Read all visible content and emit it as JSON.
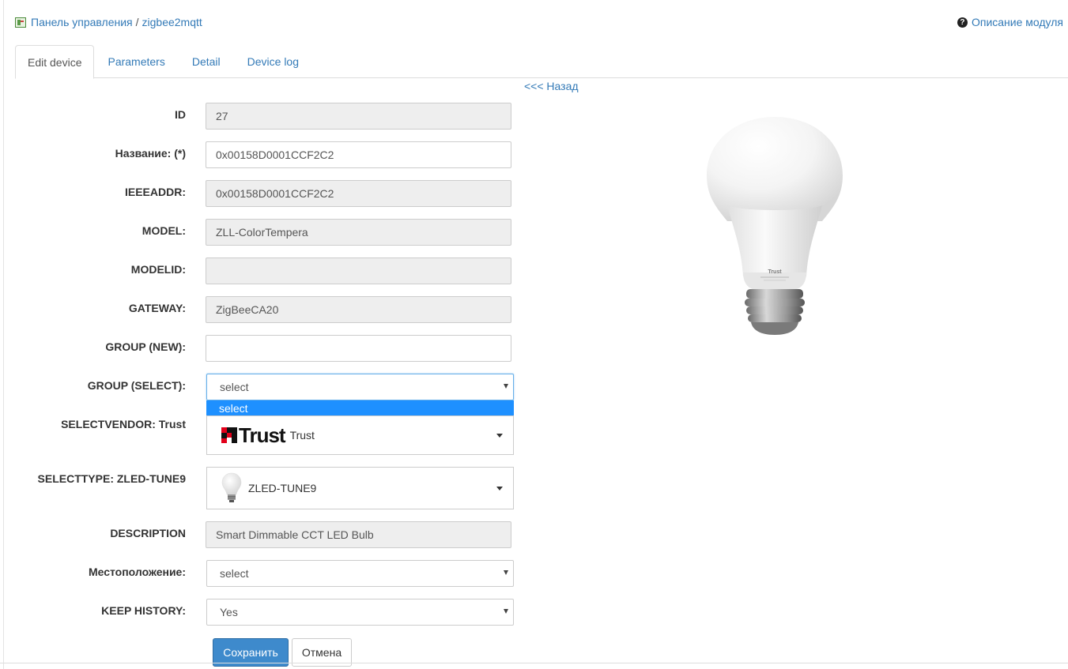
{
  "breadcrumb": {
    "home": "Панель управления",
    "separator": "/",
    "module": "zigbee2mqtt"
  },
  "help": {
    "icon": "question-circle-icon",
    "label": "Описание модуля"
  },
  "tabs": [
    {
      "label": "Edit device",
      "active": true
    },
    {
      "label": "Parameters",
      "active": false
    },
    {
      "label": "Detail",
      "active": false
    },
    {
      "label": "Device log",
      "active": false
    }
  ],
  "back_link": "<<< Назад",
  "form": {
    "id": {
      "label": "ID",
      "value": "27"
    },
    "name": {
      "label": "Название: (*)",
      "value": "0x00158D0001CCF2C2"
    },
    "ieeeaddr": {
      "label": "IEEEADDR:",
      "value": "0x00158D0001CCF2C2"
    },
    "model": {
      "label": "MODEL:",
      "value": "ZLL-ColorTempera"
    },
    "modelid": {
      "label": "MODELID:",
      "value": ""
    },
    "gateway": {
      "label": "GATEWAY:",
      "value": "ZigBeeCA20"
    },
    "group_new": {
      "label": "GROUP (NEW):",
      "value": ""
    },
    "group_select": {
      "label": "GROUP (SELECT):",
      "value": "select",
      "open_option": "select"
    },
    "vendor": {
      "label": "SELECTVENDOR: Trust",
      "logo_text": "Trust",
      "value": "Trust"
    },
    "type": {
      "label": "SELECTTYPE: ZLED-TUNE9",
      "value": "ZLED-TUNE9"
    },
    "description": {
      "label": "DESCRIPTION",
      "value": "Smart Dimmable CCT LED Bulb"
    },
    "location": {
      "label": "Местоположение:",
      "value": "select"
    },
    "keep_history": {
      "label": "KEEP HISTORY:",
      "value": "Yes"
    }
  },
  "buttons": {
    "save": "Сохранить",
    "cancel": "Отмена"
  },
  "colors": {
    "link": "#337ab7",
    "primary_button": "#3e8acc",
    "highlight_option": "#1e90ff",
    "readonly_bg": "#eeeeee",
    "trust_red": "#e2001a"
  },
  "bulb_image": {
    "brand_text": "Trust"
  }
}
